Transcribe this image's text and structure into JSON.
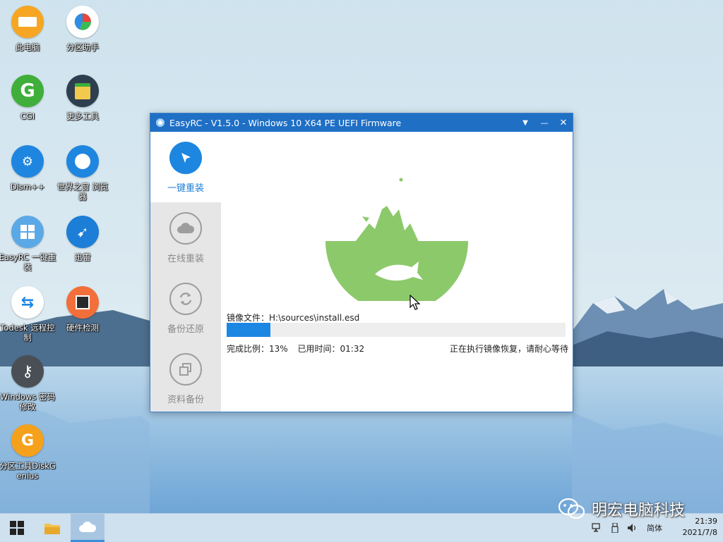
{
  "desktop": {
    "icons": [
      {
        "label": "此电脑"
      },
      {
        "label": "分区助手"
      },
      {
        "label": "CGI"
      },
      {
        "label": "更多工具"
      },
      {
        "label": "Dism++"
      },
      {
        "label": "世界之窗 浏览器"
      },
      {
        "label": "EasyRC 一键重装"
      },
      {
        "label": "迅雷"
      },
      {
        "label": "Todesk 远程控制"
      },
      {
        "label": "硬件检测"
      },
      {
        "label": "Windows 密码修改"
      },
      {
        "label": "分区工具DiskGenius"
      }
    ]
  },
  "window": {
    "title": "EasyRC - V1.5.0 - Windows 10 X64 PE UEFI Firmware",
    "controls": {
      "menu": "▼",
      "minimize": "—",
      "close": "✕"
    },
    "nav": [
      {
        "label": "一键重装",
        "active": true
      },
      {
        "label": "在线重装"
      },
      {
        "label": "备份还原"
      },
      {
        "label": "资料备份"
      }
    ],
    "image_file": "镜像文件：H:\\sources\\install.esd",
    "progress_percent": 13,
    "completion": "完成比例：13%",
    "elapsed": "已用时间：01:32",
    "status": "正在执行镜像恢复，请耐心等待"
  },
  "taskbar": {
    "ime": "简体",
    "time": "21:39",
    "date": "2021/7/8"
  },
  "watermark": "明宏电脑科技",
  "colors": {
    "accent": "#1f6fc5",
    "progress": "#1c87e3",
    "art_green": "#8cc96b"
  }
}
